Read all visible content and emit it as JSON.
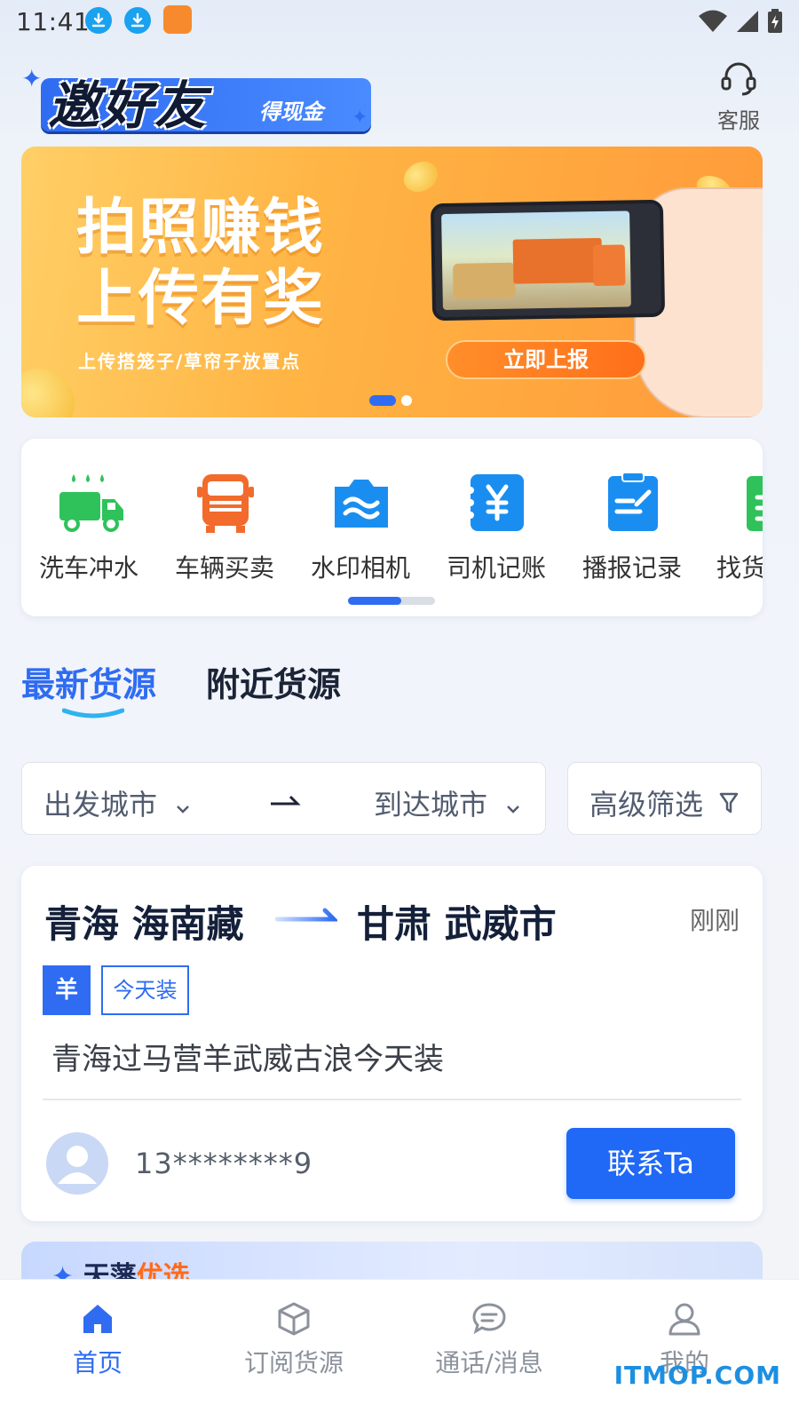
{
  "status_bar": {
    "time": "11:41",
    "notification_icons": [
      "download-icon",
      "download-icon",
      "app-icon"
    ],
    "system_icons": [
      "wifi-icon",
      "signal-icon",
      "battery-charging-icon"
    ]
  },
  "header": {
    "promo_logo_main": "邀好友",
    "promo_logo_sub": "得现金",
    "service_label": "客服",
    "service_icon": "headset-icon"
  },
  "banner": {
    "title_line1": "拍照赚钱",
    "title_line2": "上传有奖",
    "subtitle": "上传搭笼子/草帘子放置点",
    "button_label": "立即上报",
    "page_count": 2,
    "active_page": 1
  },
  "quick_menu": {
    "items": [
      {
        "label": "洗车冲水",
        "icon": "wash-truck-icon"
      },
      {
        "label": "车辆买卖",
        "icon": "truck-front-icon"
      },
      {
        "label": "水印相机",
        "icon": "watermark-camera-icon"
      },
      {
        "label": "司机记账",
        "icon": "yuan-ledger-icon"
      },
      {
        "label": "播报记录",
        "icon": "clipboard-edit-icon"
      },
      {
        "label": "找货",
        "icon": "find-cargo-icon"
      }
    ]
  },
  "tabs": {
    "active": "最新货源",
    "inactive": "附近货源"
  },
  "filters": {
    "from_city": "出发城市",
    "to_city": "到达城市",
    "advanced": "高级筛选"
  },
  "cargo": {
    "from": "青海 海南藏",
    "to": "甘肃 武威市",
    "time": "刚刚",
    "tag_type": "羊",
    "tag_load": "今天装",
    "description": "青海过马营羊武威古浪今天装",
    "phone": "13********9",
    "contact_label": "联系Ta"
  },
  "next_card": {
    "title_part1": "天藩",
    "title_part2": "优选"
  },
  "bottom_nav": {
    "items": [
      {
        "label": "首页",
        "icon": "home-icon",
        "active": true
      },
      {
        "label": "订阅货源",
        "icon": "box-icon",
        "active": false
      },
      {
        "label": "通话/消息",
        "icon": "chat-icon",
        "active": false
      },
      {
        "label": "我的",
        "icon": "user-icon",
        "active": false
      }
    ]
  },
  "watermark": "ITMOP.COM",
  "colors": {
    "accent": "#2f6cf2",
    "banner_orange": "#ff9a3a",
    "text_dark": "#14203a"
  }
}
